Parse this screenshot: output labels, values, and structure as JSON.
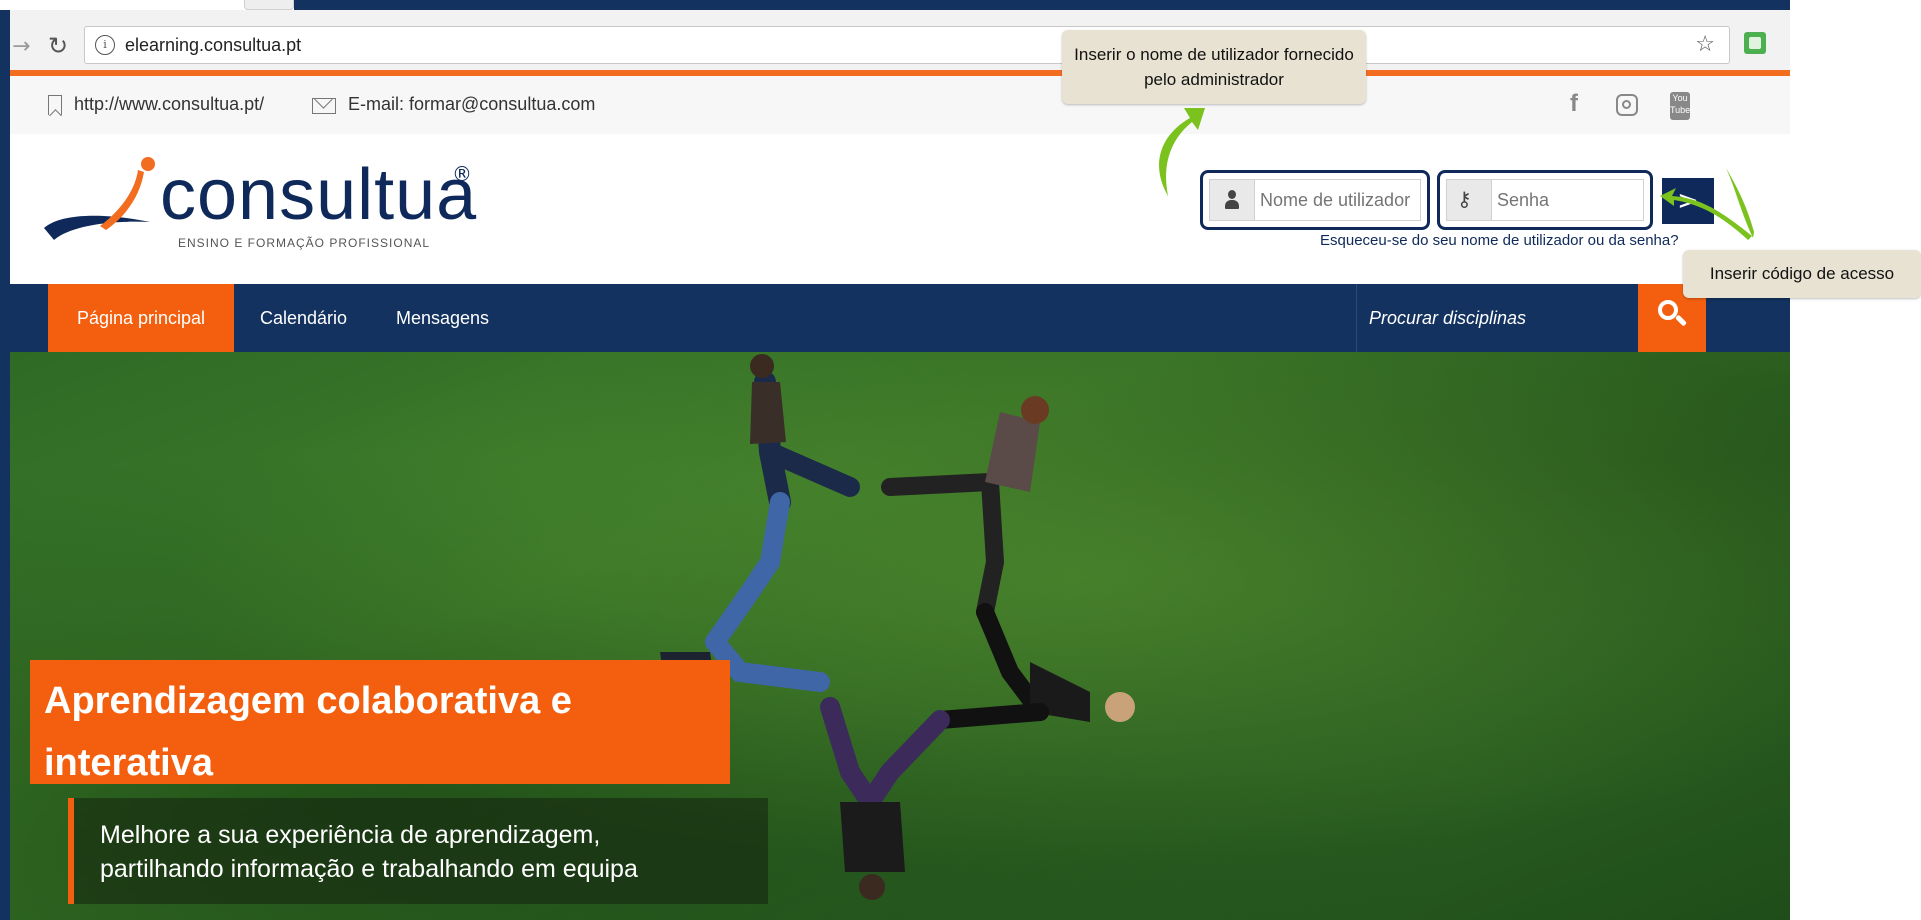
{
  "browser": {
    "url": "elearning.consultua.pt"
  },
  "infobar": {
    "site_link": "http://www.consultua.pt/",
    "email": "E-mail: formar@consultua.com",
    "social_icons": [
      "facebook-icon",
      "instagram-icon",
      "youtube-icon"
    ]
  },
  "logo": {
    "name": "consultua",
    "registered": "®",
    "tagline": "ENSINO E FORMAÇÃO PROFISSIONAL"
  },
  "login": {
    "username_placeholder": "Nome de utilizador",
    "password_placeholder": "Senha",
    "submit_label": ">",
    "forgot_link": "Esqueceu-se do seu nome de utilizador ou da senha?"
  },
  "nav": {
    "items": [
      {
        "label": "Página principal",
        "active": true
      },
      {
        "label": "Calendário"
      },
      {
        "label": "Mensagens"
      }
    ],
    "search_placeholder": "Procurar disciplinas"
  },
  "hero": {
    "title": "Aprendizagem colaborativa e interativa",
    "subtitle": "Melhore a sua experiência de aprendizagem, partilhando informação e trabalhando em equipa"
  },
  "annotations": {
    "username_note": "Inserir o nome de utilizador fornecido pelo administrador",
    "password_note": "Inserir código de acesso"
  },
  "colors": {
    "brand_navy": "#13325f",
    "brand_orange": "#f35f0e",
    "annotation_bg": "#e7e2d2",
    "arrow_green": "#7cc21e"
  }
}
